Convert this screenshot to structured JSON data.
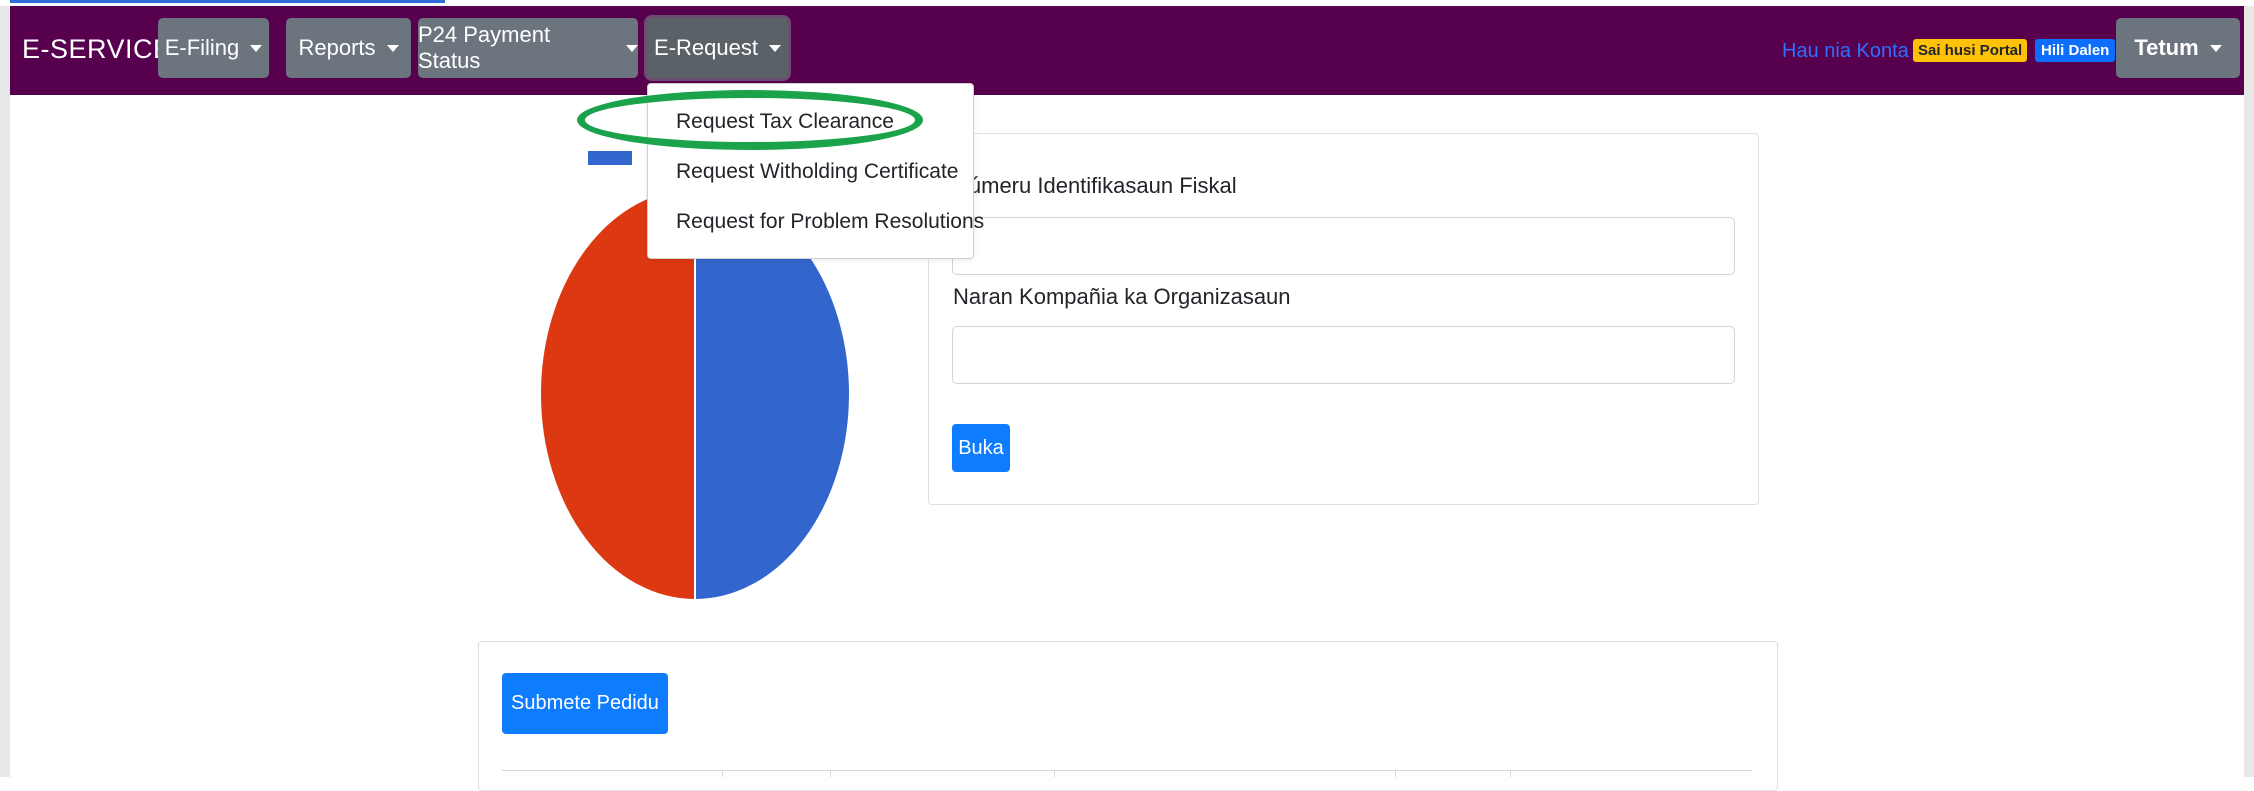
{
  "navbar": {
    "brand": "E-SERVICES",
    "menus": [
      {
        "label": "E-Filing"
      },
      {
        "label": "Reports"
      },
      {
        "label": "P24 Payment Status"
      },
      {
        "label": "E-Request"
      }
    ],
    "account_link": "Hau nia Konta",
    "badge_portal": "Sai husi Portal",
    "badge_logout": "Hili Dalen",
    "language": "Tetum"
  },
  "dropdown": {
    "items": [
      {
        "label": "Request Tax Clearance"
      },
      {
        "label": "Request Witholding Certificate"
      },
      {
        "label": "Request for Problem Resolutions"
      }
    ],
    "highlighted_index": 0
  },
  "search_form": {
    "tin_label": "Númeru Identifikasaun Fiskal",
    "tin_value": "",
    "company_label": "Naran Kompañia ka Organizasaun",
    "company_value": "",
    "search_button": "Buka"
  },
  "requests": {
    "submit_button": "Submete Pedidu"
  },
  "chart_data": {
    "type": "pie",
    "slices": [
      {
        "value": 50,
        "color": "#3366cc"
      },
      {
        "value": 50,
        "color": "#dc3912"
      }
    ]
  },
  "colors": {
    "navbar": "#56004e",
    "menu_button": "#6c757d",
    "primary": "#0d7cff",
    "highlight": "#1aa34a"
  }
}
